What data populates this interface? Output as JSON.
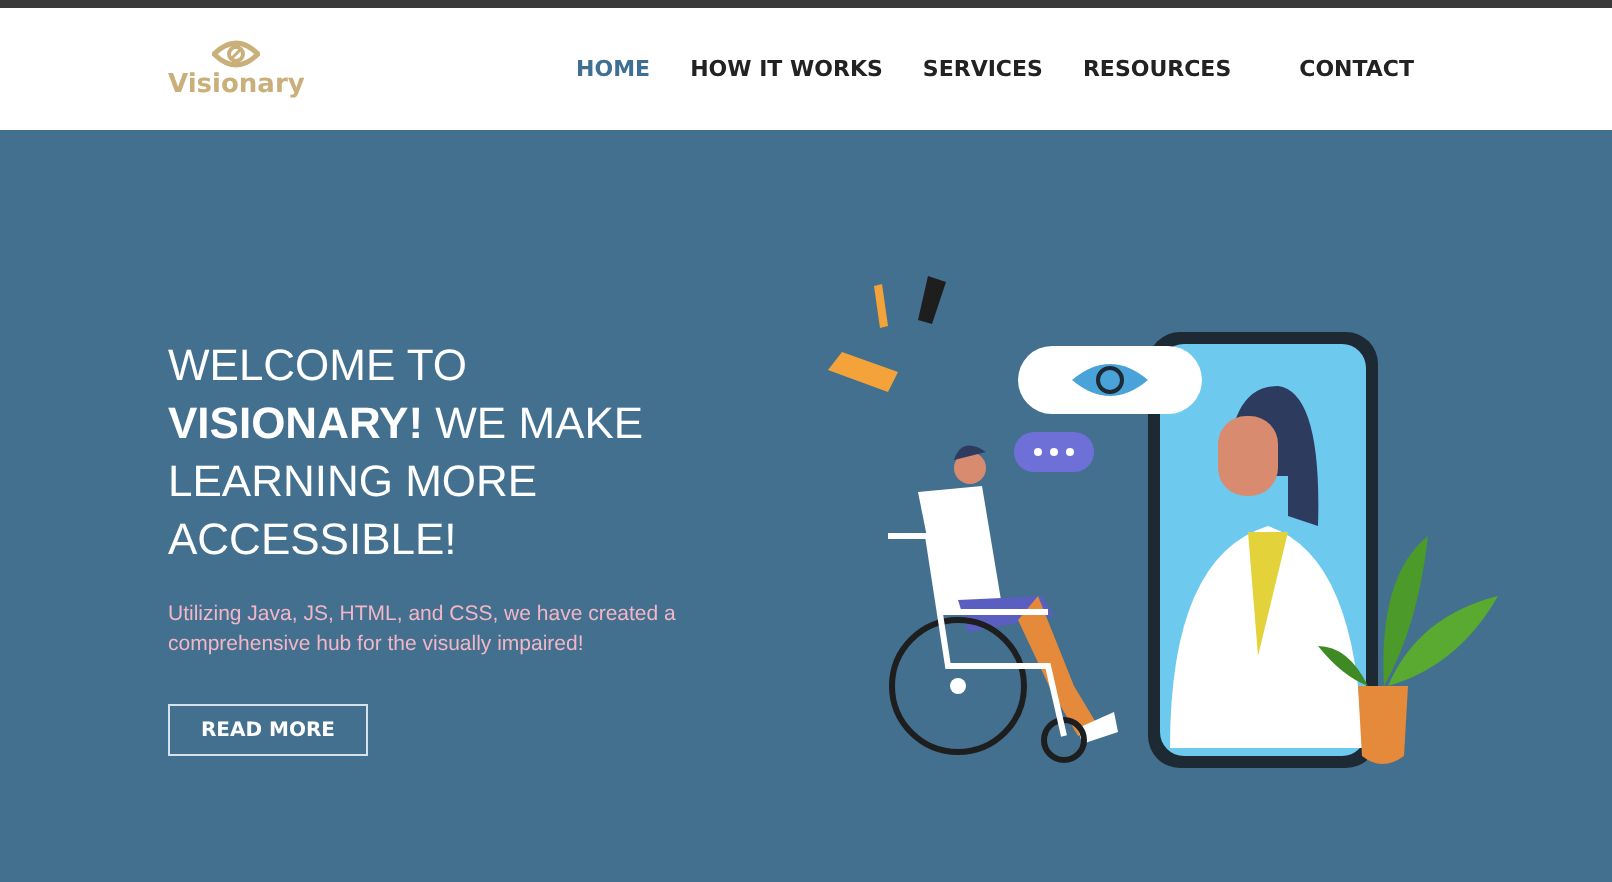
{
  "logo": {
    "name": "Visionary"
  },
  "nav": [
    {
      "label": "HOME",
      "selected": true
    },
    {
      "label": "HOW IT WORKS",
      "selected": false
    },
    {
      "label": "SERVICES",
      "selected": false
    },
    {
      "label": "RESOURCES",
      "selected": false
    },
    {
      "label": "CONTACT",
      "selected": false
    }
  ],
  "hero": {
    "headline": "WELCOME TO **VISIONARY!** WE MAKE LEARNING MORE ACCESSIBLE!",
    "text": "Utilizing Java, JS, HTML, and CSS, we have created a comprehensive hub for the visually impaired!",
    "button": "READ MORE"
  }
}
